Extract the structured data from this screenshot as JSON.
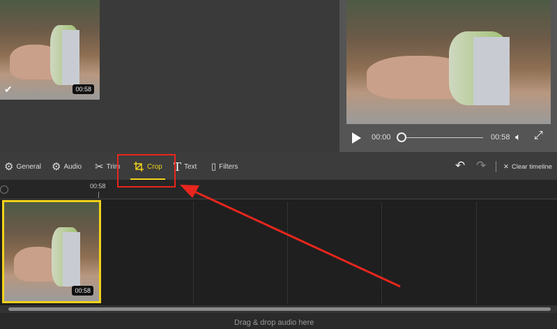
{
  "library": {
    "clip_duration": "00:58"
  },
  "player": {
    "current_time": "00:00",
    "total_time": "00:58",
    "progress": 0
  },
  "toolbar": {
    "general": "General",
    "audio": "Audio",
    "trim": "Trim",
    "crop": "Crop",
    "text": "Text",
    "filters": "Filters",
    "clear": "Clear timeline"
  },
  "timeline": {
    "ruler_mark": "00:58",
    "clip_duration": "00:58",
    "audio_drop": "Drag & drop audio here"
  },
  "colors": {
    "accent": "#f2d21b",
    "annotation": "#e8261d"
  }
}
